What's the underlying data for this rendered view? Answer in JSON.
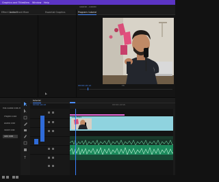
{
  "menubar": {
    "items": [
      "Graphics and Titles",
      "View",
      "Window",
      "Help"
    ]
  },
  "window": {
    "title": "Tutorial - Edited"
  },
  "left_panel": {
    "tabs": [
      {
        "label": "Effect Controls",
        "active": true
      },
      {
        "label": "Audio Track Mixer"
      },
      {
        "label": "Essential Graphics"
      }
    ]
  },
  "program_monitor": {
    "tab_label": "Program: tutorial",
    "timecode": "00:00:10:15",
    "scale_label": "Fit"
  },
  "project_panel": {
    "items": [
      "Mix Audio Edit.mp4",
      "Project Edit",
      "Audio Edit",
      "Voice Edit",
      "Still Edit"
    ],
    "selected_index": 4
  },
  "timeline": {
    "tab_label": "tutorial",
    "timecode": "00:00:10:15",
    "ruler_label": "00:00:15:00",
    "clip_label": "Clip.mp4",
    "tracks": [
      "V3",
      "V2",
      "V1",
      "A1",
      "A2",
      "A3"
    ]
  },
  "colors": {
    "accent": "#5b34c4",
    "playhead": "#3a82ff",
    "video_clip": "#8fd3df",
    "audio_clip": "#1c8a5c",
    "label_pink": "#e86ad8"
  }
}
